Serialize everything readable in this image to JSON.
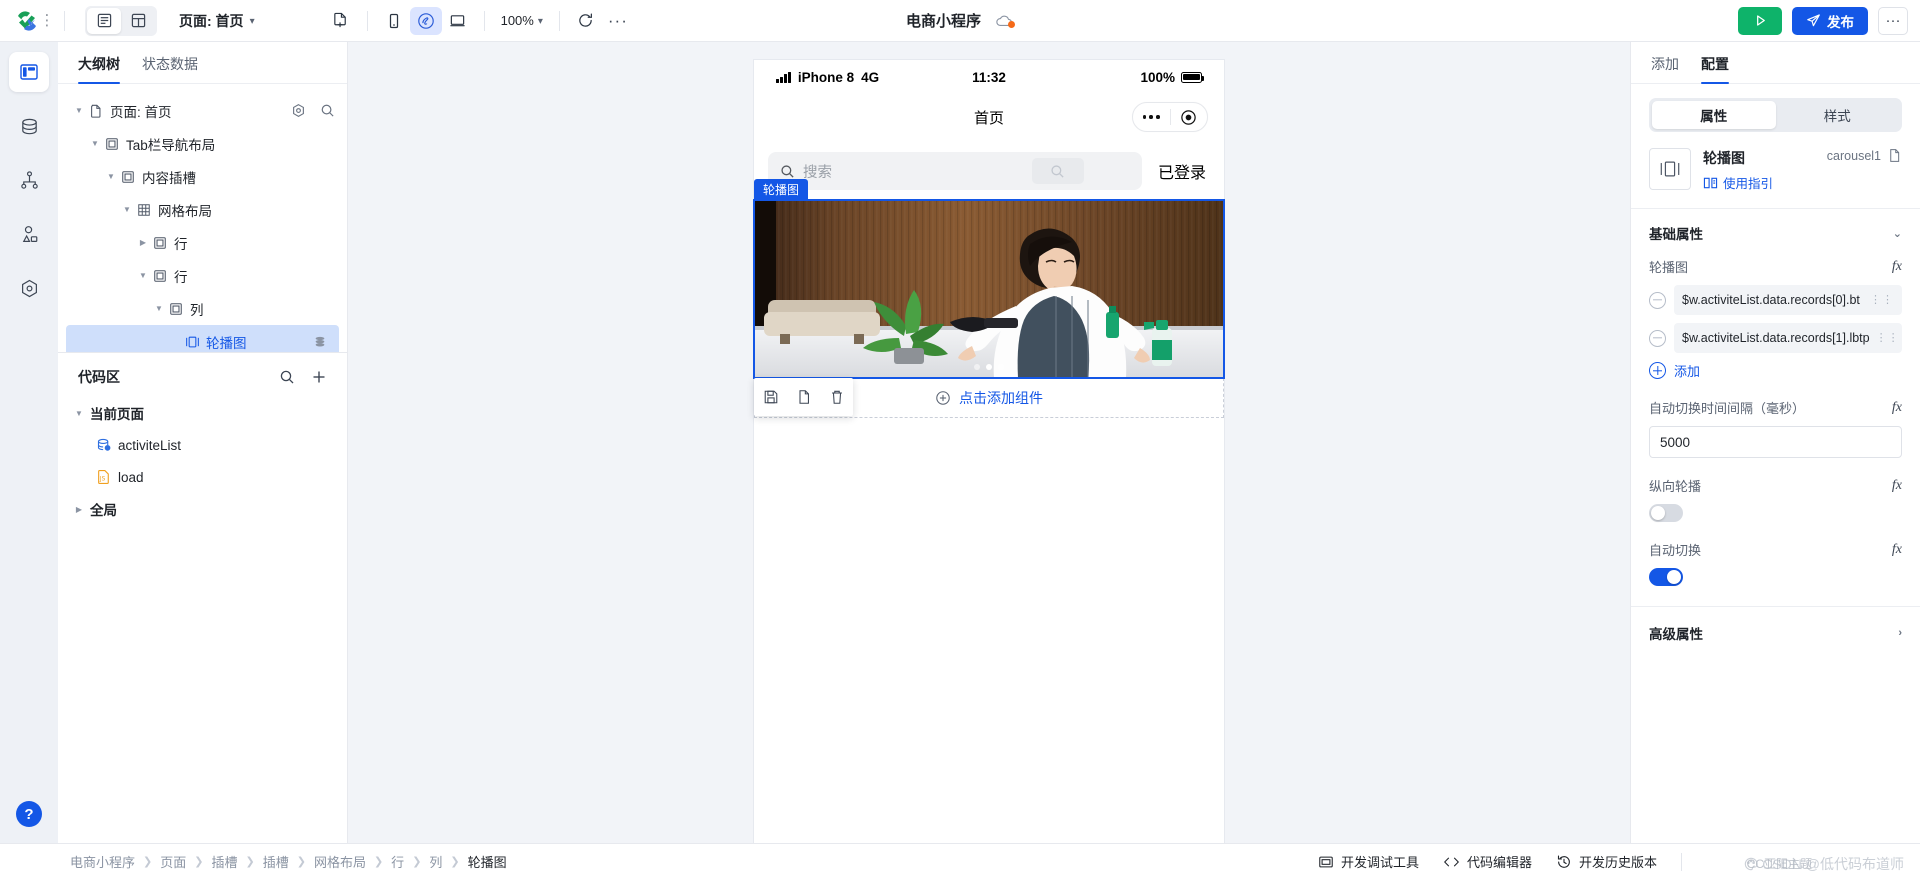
{
  "topbar": {
    "view_list_icon": "list-view-icon",
    "view_grid_icon": "grid-view-icon",
    "page_label": "页面: 首页",
    "new_page_icon": "new-page-icon",
    "device_phone_icon": "phone-device-icon",
    "device_mini_icon": "miniprogram-device-icon",
    "device_desktop_icon": "desktop-device-icon",
    "zoom_level": "100%",
    "refresh_icon": "refresh-icon",
    "more_dots": "···",
    "project_title": "电商小程序",
    "cloud_icon": "cloud-sync-icon",
    "run_icon": "play-icon",
    "publish_label": "发布",
    "publish_icon": "send-icon",
    "more_label": "···",
    "accent": "#1457e6",
    "run_color": "#0eb36a"
  },
  "rail": {
    "items": [
      {
        "name": "sidebar-item-layout",
        "icon": "panel-layout-icon",
        "active": true
      },
      {
        "name": "sidebar-item-data",
        "icon": "database-icon",
        "active": false
      },
      {
        "name": "sidebar-item-flow",
        "icon": "sitemap-icon",
        "active": false
      },
      {
        "name": "sidebar-item-components",
        "icon": "shapes-icon",
        "active": false
      },
      {
        "name": "sidebar-item-settings",
        "icon": "hexagon-gear-icon",
        "active": false
      }
    ],
    "help_label": "?"
  },
  "left_panel": {
    "tabs": [
      {
        "label": "大纲树",
        "active": true
      },
      {
        "label": "状态数据",
        "active": false
      }
    ],
    "tree": [
      {
        "label": "页面: 首页",
        "indent": 0,
        "arrow": "down",
        "icon": "page-icon",
        "selected": false,
        "tools": [
          "gear-icon",
          "search-icon"
        ]
      },
      {
        "label": "Tab栏导航布局",
        "indent": 1,
        "arrow": "down",
        "icon": "container-icon",
        "selected": false
      },
      {
        "label": "内容插槽",
        "indent": 2,
        "arrow": "down",
        "icon": "container-icon",
        "selected": false
      },
      {
        "label": "网格布局",
        "indent": 3,
        "arrow": "down",
        "icon": "grid-icon",
        "selected": false
      },
      {
        "label": "行",
        "indent": 4,
        "arrow": "right",
        "icon": "container-icon",
        "selected": false
      },
      {
        "label": "行",
        "indent": 4,
        "arrow": "down",
        "icon": "container-icon",
        "selected": false
      },
      {
        "label": "列",
        "indent": 5,
        "arrow": "down",
        "icon": "container-icon",
        "selected": false
      },
      {
        "label": "轮播图",
        "indent": 6,
        "arrow": "none",
        "icon": "carousel-icon",
        "selected": true,
        "tools": [
          "layers-icon"
        ]
      }
    ],
    "code_zone": {
      "title": "代码区",
      "search_icon": "search-icon",
      "add_icon": "plus-icon",
      "rows": [
        {
          "label": "当前页面",
          "group": true,
          "arrow": "down",
          "icon": "none",
          "indent": 0
        },
        {
          "label": "activiteList",
          "group": false,
          "arrow": "none",
          "icon": "dataset-icon",
          "indent": 1
        },
        {
          "label": "load",
          "group": false,
          "arrow": "none",
          "icon": "js-file-icon",
          "indent": 1
        },
        {
          "label": "全局",
          "group": true,
          "arrow": "right",
          "icon": "none",
          "indent": 0
        }
      ]
    }
  },
  "preview": {
    "status": {
      "signal_icon": "signal-bars-icon",
      "device": "iPhone 8",
      "network": "4G",
      "time": "11:32",
      "battery_pct": "100%",
      "battery_icon": "battery-icon"
    },
    "nav_title": "首页",
    "capsule": {
      "dots_icon": "more-dots-icon",
      "target_icon": "target-circle-icon"
    },
    "search_placeholder": "搜索",
    "search_icon": "search-icon",
    "login_label": "已登录",
    "carousel_tag": "轮播图",
    "carousel_dots": 3,
    "carousel_active_dot": 1,
    "float_tools": [
      {
        "name": "save-component-button",
        "icon": "save-icon"
      },
      {
        "name": "copy-component-button",
        "icon": "copy-icon"
      },
      {
        "name": "delete-component-button",
        "icon": "trash-icon"
      }
    ],
    "add_component_label": "点击添加组件",
    "add_component_icon": "plus-circle-icon"
  },
  "right_panel": {
    "tabs": [
      {
        "label": "添加",
        "active": false
      },
      {
        "label": "配置",
        "active": true
      }
    ],
    "segments": [
      {
        "label": "属性",
        "active": true
      },
      {
        "label": "样式",
        "active": false
      }
    ],
    "component": {
      "thumb_icon": "carousel-icon",
      "name": "轮播图",
      "guide_label": "使用指引",
      "guide_icon": "book-icon",
      "id": "carousel1",
      "copy_icon": "copy-icon"
    },
    "basic_section": {
      "title": "基础属性",
      "chevron": "chevron-down-icon"
    },
    "props": [
      {
        "type": "bindings",
        "label": "轮播图",
        "fx": "fx",
        "items": [
          "$w.activiteList.data.records[0].bt",
          "$w.activiteList.data.records[1].lbtp"
        ],
        "add_label": "添加"
      },
      {
        "type": "text",
        "label": "自动切换时间间隔（毫秒）",
        "fx": "fx",
        "value": "5000"
      },
      {
        "type": "toggle",
        "label": "纵向轮播",
        "fx": "fx",
        "on": false
      },
      {
        "type": "toggle",
        "label": "自动切换",
        "fx": "fx",
        "on": true
      }
    ],
    "advanced_section": {
      "title": "高级属性",
      "chevron": "chevron-right-icon"
    }
  },
  "bottombar": {
    "breadcrumb": [
      "电商小程序",
      "页面",
      "插槽",
      "插槽",
      "网格布局",
      "行",
      "列",
      "轮播图"
    ],
    "actions": [
      {
        "label": "开发调试工具",
        "icon": "debug-window-icon"
      },
      {
        "label": "代码编辑器",
        "icon": "code-brackets-icon"
      },
      {
        "label": "开发历史版本",
        "icon": "history-clock-icon"
      }
    ],
    "watermark": "CSDN @低代码布道师",
    "watermark_overlay": "CC亚阳主题"
  }
}
